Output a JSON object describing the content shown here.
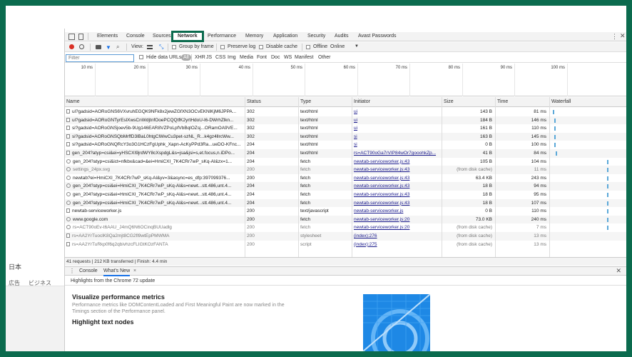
{
  "browser": {
    "lang_label": "日本",
    "links": [
      "広告",
      "ビジネス"
    ]
  },
  "devtools": {
    "tabs": [
      "Elements",
      "Console",
      "Sources",
      "Network",
      "Performance",
      "Memory",
      "Application",
      "Security",
      "Audits",
      "Avast Passwords"
    ],
    "active_tab": "Network"
  },
  "toolbar": {
    "view_label": "View:",
    "group_by_frame": "Group by frame",
    "preserve_log": "Preserve log",
    "disable_cache": "Disable cache",
    "offline": "Offline",
    "throttle": "Online"
  },
  "filter": {
    "placeholder": "Filter",
    "hide_data_urls": "Hide data URLs",
    "types": [
      "All",
      "XHR",
      "JS",
      "CSS",
      "Img",
      "Media",
      "Font",
      "Doc",
      "WS",
      "Manifest",
      "Other"
    ]
  },
  "overview_ticks": [
    "10 ms",
    "20 ms",
    "30 ms",
    "40 ms",
    "50 ms",
    "60 ms",
    "70 ms",
    "80 ms",
    "90 ms",
    "100 ms"
  ],
  "columns": [
    "Name",
    "Status",
    "Type",
    "Initiator",
    "Size",
    "Time",
    "Waterfall"
  ],
  "rows": [
    {
      "name": "ui?gadsid=AORoGNS6VXvruhEGQK9NFk8x2jewZGfXN3OCvEKNlKjM6JPPA...",
      "status": "302",
      "type": "text/html",
      "initiator": "ui",
      "size": "143 B",
      "time": "81 ms",
      "icon": "file",
      "gray": false
    },
    {
      "name": "ui?gadsid=AORoGNTyrEslXwsCnWdjtnfOoePCQQtfK2yrtHdoU-l6-DWrhZlkn...",
      "status": "302",
      "type": "text/html",
      "initiator": "ui",
      "size": "184 B",
      "time": "146 ms",
      "icon": "file",
      "gray": false
    },
    {
      "name": "si?gadsid=AORoGNSjoev5b-9Ug146EAR8VZPoLpfVbBqlOZsj...ORamOA9VE...",
      "status": "302",
      "type": "text/html",
      "initiator": "ui",
      "size": "161 B",
      "time": "110 ms",
      "icon": "file",
      "gray": false
    },
    {
      "name": "si?gadsid=AORoGNSQbMrffD3lBaL0htgClWwCu3pet-szNL_R...k4gz4llrcWw...",
      "status": "302",
      "type": "text/html",
      "initiator": "si",
      "size": "163 B",
      "time": "145 ms",
      "icon": "file",
      "gray": false
    },
    {
      "name": "si?gadsid=AORoGNQRcY3o3G1HCzFgUphk_Xapn-AcKyPPd3Ra...ueDO-KFnc...",
      "status": "204",
      "type": "text/html",
      "initiator": "si",
      "size": "0 B",
      "time": "100 ms",
      "icon": "file",
      "gray": false
    },
    {
      "name": "gen_204?atyp=csi&ei=yHSCXI9jrdWY8cXspdgL&s=jsa&jsi=s,et.focus,n.iDPo...",
      "status": "204",
      "type": "text/html",
      "initiator": "rs=ACT90oGa7rVIP84wOr7gooohkZp...",
      "size": "41 B",
      "time": "84 ms",
      "icon": "file",
      "gray": false
    },
    {
      "name": "gen_204?atyp=csi&ict=nfkbx&cad=&ei=HmiCXI_7K4CRr7wP_sKq-Al&zx=1...",
      "status": "204",
      "type": "fetch",
      "initiator": "newtab-serviceworker.js:43",
      "size": "105 B",
      "time": "104 ms",
      "icon": "gear",
      "gray": false
    },
    {
      "name": "settings_24px.svg",
      "status": "200",
      "type": "fetch",
      "initiator": "newtab-serviceworker.js:43",
      "size": "(from disk cache)",
      "time": "11 ms",
      "icon": "gear",
      "gray": true
    },
    {
      "name": "newtab?ei=HmiCXI_7K4CRr7wP_sKq-Al&yv=3&async=es_dfp:397099376...",
      "status": "200",
      "type": "fetch",
      "initiator": "newtab-serviceworker.js:43",
      "size": "63.4 KB",
      "time": "243 ms",
      "icon": "gear",
      "gray": false
    },
    {
      "name": "gen_204?atyp=csi&ei=HmiCXI_7K4CRr7wP_sKq-Al&s=newt...stt.486,unt.4...",
      "status": "204",
      "type": "fetch",
      "initiator": "newtab-serviceworker.js:43",
      "size": "18 B",
      "time": "94 ms",
      "icon": "gear",
      "gray": false
    },
    {
      "name": "gen_204?atyp=csi&ei=HmiCXI_7K4CRr7wP_sKq-Al&s=newt...stt.486,unt.4...",
      "status": "204",
      "type": "fetch",
      "initiator": "newtab-serviceworker.js:43",
      "size": "18 B",
      "time": "95 ms",
      "icon": "gear",
      "gray": false
    },
    {
      "name": "gen_204?atyp=csi&ei=HmiCXI_7K4CRr7wP_sKq-Al&s=newt...stt.486,unt.4...",
      "status": "204",
      "type": "fetch",
      "initiator": "newtab-serviceworker.js:43",
      "size": "18 B",
      "time": "107 ms",
      "icon": "gear",
      "gray": false
    },
    {
      "name": "newtab-serviceworker.js",
      "status": "200",
      "type": "text/javascript",
      "initiator": "newtab-serviceworker.js",
      "size": "0 B",
      "time": "110 ms",
      "icon": "file",
      "gray": false
    },
    {
      "name": "www.google.com",
      "status": "200",
      "type": "fetch",
      "initiator": "newtab-serviceworker.js:20",
      "size": "73.0 KB",
      "time": "240 ms",
      "icon": "gear",
      "gray": false
    },
    {
      "name": "rs=ACT90oEv-t6AAU_J4mQ6N6OCinqBUUadlg",
      "status": "200",
      "type": "fetch",
      "initiator": "newtab-serviceworker.js:20",
      "size": "(from disk cache)",
      "time": "7 ms",
      "icon": "gear",
      "gray": true
    },
    {
      "name": "rs=AA2YrTuoclK8Qa2mjt8CG2fl9wtEpPMWMA",
      "status": "200",
      "type": "stylesheet",
      "initiator": "(index):276",
      "size": "(from disk cache)",
      "time": "13 ms",
      "icon": "file",
      "gray": true
    },
    {
      "name": "rs=AA2YrTuRkp0f6q2qbivhzcFLIGtKOzFANTA",
      "status": "200",
      "type": "script",
      "initiator": "(index):275",
      "size": "(from disk cache)",
      "time": "13 ms",
      "icon": "file",
      "gray": true
    }
  ],
  "status_bar": "41 requests | 212 KB transferred | Finish: 4.4 min",
  "drawer": {
    "tabs": [
      "Console",
      "What's New"
    ],
    "active_tab": "What's New",
    "subtitle": "Highlights from the Chrome 72 update",
    "title1": "Visualize performance metrics",
    "desc1": "Performance metrics like DOMContentLoaded and First Meaningful Paint are now marked in the Timings section of the Performance panel.",
    "title2": "Highlight text nodes"
  },
  "colors": {
    "frame": "#0b6b4e",
    "accent": "#1a73e8",
    "record": "#d93025",
    "waterfall": "#5ba8d8",
    "promo": "#1e88e5"
  }
}
